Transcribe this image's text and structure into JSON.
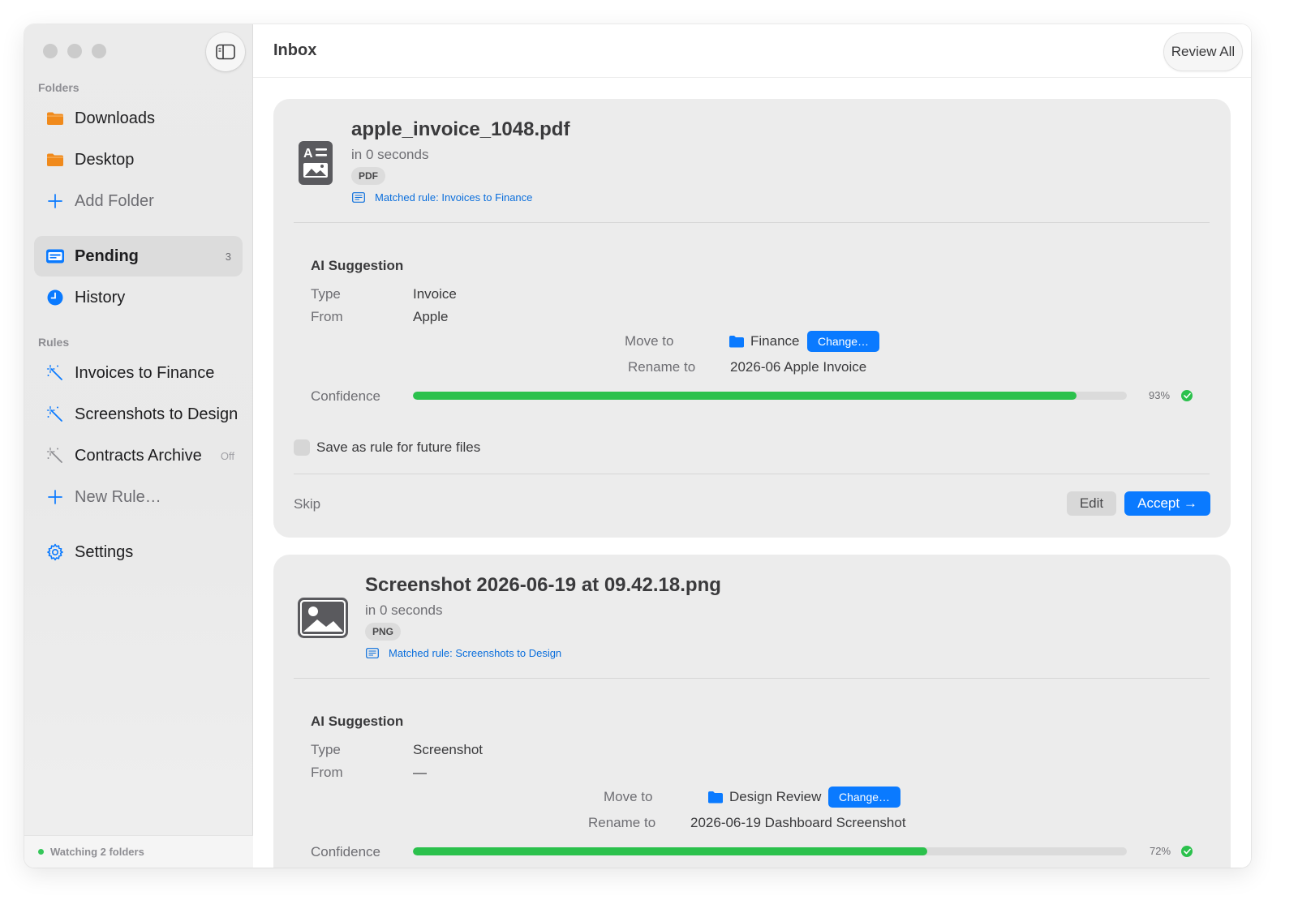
{
  "app": {
    "window_controls": [
      "close",
      "minimize",
      "zoom"
    ],
    "sidebar_toggle_icon": "sidebar-icon"
  },
  "sidebar": {
    "folders_label": "Folders",
    "folders": [
      {
        "label": "Downloads",
        "icon": "folder-icon",
        "color": "#f08a1c"
      },
      {
        "label": "Desktop",
        "icon": "folder-icon",
        "color": "#f08a1c"
      }
    ],
    "add_folder_label": "Add Folder",
    "views": [
      {
        "label": "Pending",
        "icon": "tray-icon",
        "count": "3",
        "selected": true
      },
      {
        "label": "History",
        "icon": "clock-icon",
        "selected": false
      }
    ],
    "rules_label": "Rules",
    "rules": [
      {
        "label": "Invoices to Finance",
        "icon": "magic-wand-icon",
        "enabled": true
      },
      {
        "label": "Screenshots to Design",
        "icon": "magic-wand-icon",
        "enabled": true
      },
      {
        "label": "Contracts Archive",
        "icon": "magic-wand-icon",
        "enabled": false,
        "status": "Off"
      }
    ],
    "new_rule_label": "New Rule…",
    "settings_label": "Settings",
    "footer_status": "Watching 2 folders"
  },
  "toolbar": {
    "title": "Inbox",
    "review_all_label": "Review All"
  },
  "cards": [
    {
      "file_name": "apple_invoice_1048.pdf",
      "time": "in 0 seconds",
      "badge": "PDF",
      "file_icon": "document-icon",
      "matched_rule": "Matched rule: Invoices to Finance",
      "suggestion_title": "AI Suggestion",
      "type_label": "Type",
      "type_value": "Invoice",
      "from_label": "From",
      "from_value": "Apple",
      "move_label": "Move to",
      "move_value": "Finance",
      "change_label": "Change…",
      "rename_label": "Rename to",
      "rename_value": "2026-06 Apple Invoice",
      "confidence_label": "Confidence",
      "confidence": 0.93,
      "confidence_text": "93%",
      "save_rule_label": "Save as rule for future files",
      "skip_label": "Skip",
      "edit_label": "Edit",
      "accept_label": "Accept →"
    },
    {
      "file_name": "Screenshot 2026-06-19 at 09.42.18.png",
      "time": "in 0 seconds",
      "badge": "PNG",
      "file_icon": "image-icon",
      "matched_rule": "Matched rule: Screenshots to Design",
      "suggestion_title": "AI Suggestion",
      "type_label": "Type",
      "type_value": "Screenshot",
      "from_label": "From",
      "from_value": "—",
      "move_label": "Move to",
      "move_value": "Design Review",
      "change_label": "Change…",
      "rename_label": "Rename to",
      "rename_value": "2026-06-19 Dashboard Screenshot",
      "confidence_label": "Confidence",
      "confidence": 0.72,
      "confidence_text": "72%"
    }
  ],
  "colors": {
    "accent": "#0a7aff",
    "confidence": "#2bc14c",
    "folder": "#f08a1c",
    "link": "#0a6edc"
  }
}
